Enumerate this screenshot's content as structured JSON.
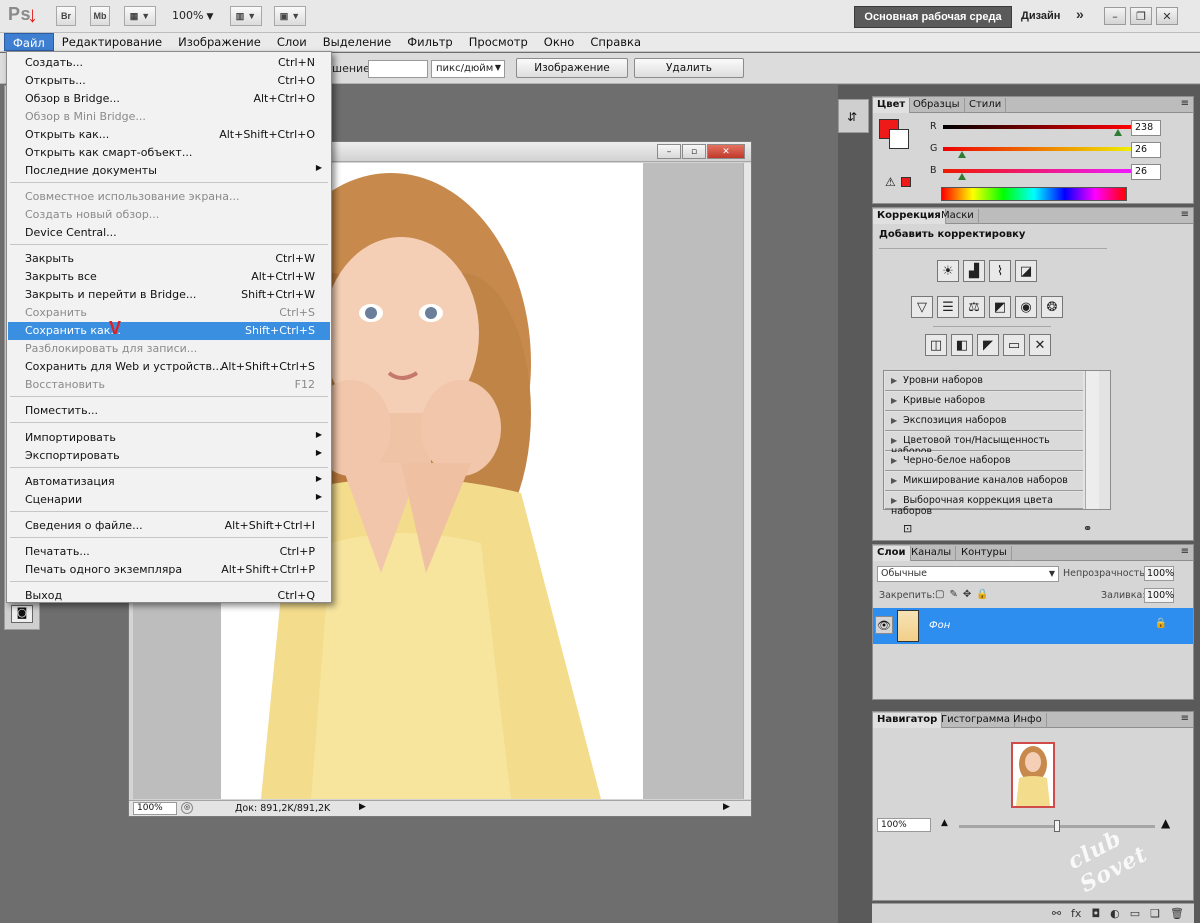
{
  "appbar": {
    "logo": "Ps",
    "br": "Br",
    "mb": "Mb",
    "zoom": "100%",
    "workspace_active": "Основная рабочая среда",
    "workspace_design": "Дизайн",
    "more": "»"
  },
  "menubar": {
    "items": [
      "Файл",
      "Редактирование",
      "Изображение",
      "Слои",
      "Выделение",
      "Фильтр",
      "Просмотр",
      "Окно",
      "Справка"
    ]
  },
  "options": {
    "resolution_label": "шение:",
    "resolution_value": "",
    "units": "пикс/дюйм",
    "image_button": "Изображение",
    "delete_button": "Удалить"
  },
  "file_menu": {
    "items": [
      {
        "label": "Создать...",
        "shortcut": "Ctrl+N"
      },
      {
        "label": "Открыть...",
        "shortcut": "Ctrl+O"
      },
      {
        "label": "Обзор в Bridge...",
        "shortcut": "Alt+Ctrl+O"
      },
      {
        "label": "Обзор в Mini Bridge...",
        "shortcut": ""
      },
      {
        "label": "Открыть как...",
        "shortcut": "Alt+Shift+Ctrl+O"
      },
      {
        "label": "Открыть как смарт-объект...",
        "shortcut": ""
      },
      {
        "label": "Последние документы",
        "shortcut": ""
      },
      {
        "label": "Совместное использование экрана...",
        "shortcut": ""
      },
      {
        "label": "Создать новый обзор...",
        "shortcut": ""
      },
      {
        "label": "Device Central...",
        "shortcut": ""
      },
      {
        "label": "Закрыть",
        "shortcut": "Ctrl+W"
      },
      {
        "label": "Закрыть все",
        "shortcut": "Alt+Ctrl+W"
      },
      {
        "label": "Закрыть и перейти в Bridge...",
        "shortcut": "Shift+Ctrl+W"
      },
      {
        "label": "Сохранить",
        "shortcut": "Ctrl+S"
      },
      {
        "label": "Сохранить как...",
        "shortcut": "Shift+Ctrl+S"
      },
      {
        "label": "Разблокировать для записи...",
        "shortcut": ""
      },
      {
        "label": "Сохранить для Web и устройств...",
        "shortcut": "Alt+Shift+Ctrl+S"
      },
      {
        "label": "Восстановить",
        "shortcut": "F12"
      },
      {
        "label": "Поместить...",
        "shortcut": ""
      },
      {
        "label": "Импортировать",
        "shortcut": ""
      },
      {
        "label": "Экспортировать",
        "shortcut": ""
      },
      {
        "label": "Автоматизация",
        "shortcut": ""
      },
      {
        "label": "Сценарии",
        "shortcut": ""
      },
      {
        "label": "Сведения о файле...",
        "shortcut": "Alt+Shift+Ctrl+I"
      },
      {
        "label": "Печатать...",
        "shortcut": "Ctrl+P"
      },
      {
        "label": "Печать одного экземпляра",
        "shortcut": "Alt+Shift+Ctrl+P"
      },
      {
        "label": "Выход",
        "shortcut": "Ctrl+Q"
      }
    ],
    "highlight_mark": "V"
  },
  "document": {
    "zoom": "100%",
    "info": "Док: 891,2K/891,2K"
  },
  "color_panel": {
    "tabs": [
      "Цвет",
      "Образцы",
      "Стили"
    ],
    "r_label": "R",
    "g_label": "G",
    "b_label": "B",
    "r": "238",
    "g": "26",
    "b": "26",
    "r_level": 0.93,
    "g_level": 0.1,
    "b_level": 0.1,
    "fg_color": "#ee1a1a"
  },
  "adjust_panel": {
    "tabs": [
      "Коррекция",
      "Маски"
    ],
    "title": "Добавить корректировку",
    "presets": [
      "Уровни наборов",
      "Кривые наборов",
      "Экспозиция наборов",
      "Цветовой тон/Насыщенность наборов",
      "Черно-белое наборов",
      "Микширование каналов наборов",
      "Выборочная коррекция цвета наборов"
    ]
  },
  "layers_panel": {
    "tabs": [
      "Слои",
      "Каналы",
      "Контуры"
    ],
    "blend_mode": "Обычные",
    "opacity_label": "Непрозрачность:",
    "opacity": "100%",
    "lock_label": "Закрепить:",
    "fill_label": "Заливка:",
    "fill": "100%",
    "layer_name": "Фон"
  },
  "navigator_panel": {
    "tabs": [
      "Навигатор",
      "Гистограмма",
      "Инфо"
    ],
    "zoom": "100%",
    "zoom_level": 0.5
  },
  "watermark": "club Sovet",
  "colors": {
    "highlight": "#3b8fe0",
    "layer_selected": "#2e8ef0",
    "workspace_active": "#5a5a5a",
    "accent_red": "#e02020"
  }
}
